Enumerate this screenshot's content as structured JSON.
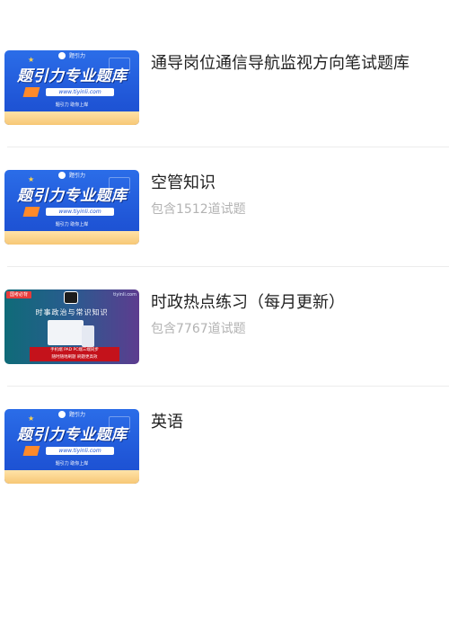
{
  "items": [
    {
      "title": "通导岗位通信导航监视方向笔试题库",
      "subtitle": "",
      "thumb": {
        "type": "brand",
        "logo_text": "题引力",
        "headline": "题引力专业题库",
        "url": "www.tiyinli.com",
        "tagline": "题引力 助你上岸"
      }
    },
    {
      "title": "空管知识",
      "subtitle": "包含1512道试题",
      "thumb": {
        "type": "brand",
        "logo_text": "题引力",
        "headline": "题引力专业题库",
        "url": "www.tiyinli.com",
        "tagline": "题引力 助你上岸"
      }
    },
    {
      "title": "时政热点练习（每月更新）",
      "subtitle": "包含7767道试题",
      "thumb": {
        "type": "politics",
        "badge": "国考必背",
        "site": "tiyinli.com",
        "headline": "时事政治与常识知识",
        "footer_line1": "手机端  PAD  PC端三端同步",
        "footer_line2": "随时随地刷题 刷题更高效"
      }
    },
    {
      "title": "英语",
      "subtitle": "",
      "thumb": {
        "type": "brand",
        "logo_text": "题引力",
        "headline": "题引力专业题库",
        "url": "www.tiyinli.com",
        "tagline": "题引力 助你上岸"
      }
    }
  ]
}
